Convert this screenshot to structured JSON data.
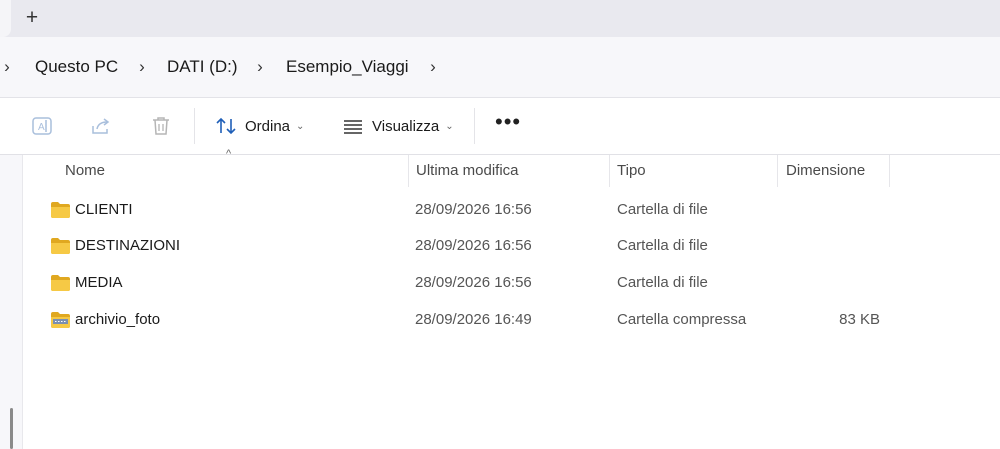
{
  "tabs": {
    "new_tab_label": "+"
  },
  "breadcrumb": {
    "items": [
      "Questo PC",
      "DATI (D:)",
      "Esempio_Viaggi"
    ],
    "separator": "›"
  },
  "toolbar": {
    "sort_label": "Ordina",
    "view_label": "Visualizza",
    "more_label": "•••",
    "icons": [
      "rename-icon",
      "share-icon",
      "delete-icon"
    ]
  },
  "columns": {
    "name": "Nome",
    "modified": "Ultima modifica",
    "type": "Tipo",
    "size": "Dimensione"
  },
  "files": [
    {
      "name": "CLIENTI",
      "modified": "28/09/2026 16:56",
      "type": "Cartella di file",
      "size": "",
      "icon": "folder-icon"
    },
    {
      "name": "DESTINAZIONI",
      "modified": "28/09/2026 16:56",
      "type": "Cartella di file",
      "size": "",
      "icon": "folder-icon"
    },
    {
      "name": "MEDIA",
      "modified": "28/09/2026 16:56",
      "type": "Cartella di file",
      "size": "",
      "icon": "folder-icon"
    },
    {
      "name": "archivio_foto",
      "modified": "28/09/2026 16:49",
      "type": "Cartella compressa",
      "size": "83 KB",
      "icon": "zip-folder-icon"
    }
  ],
  "colors": {
    "folder": "#f3c33c",
    "folder_dark": "#e0a820",
    "accent": "#1f5fb8"
  }
}
